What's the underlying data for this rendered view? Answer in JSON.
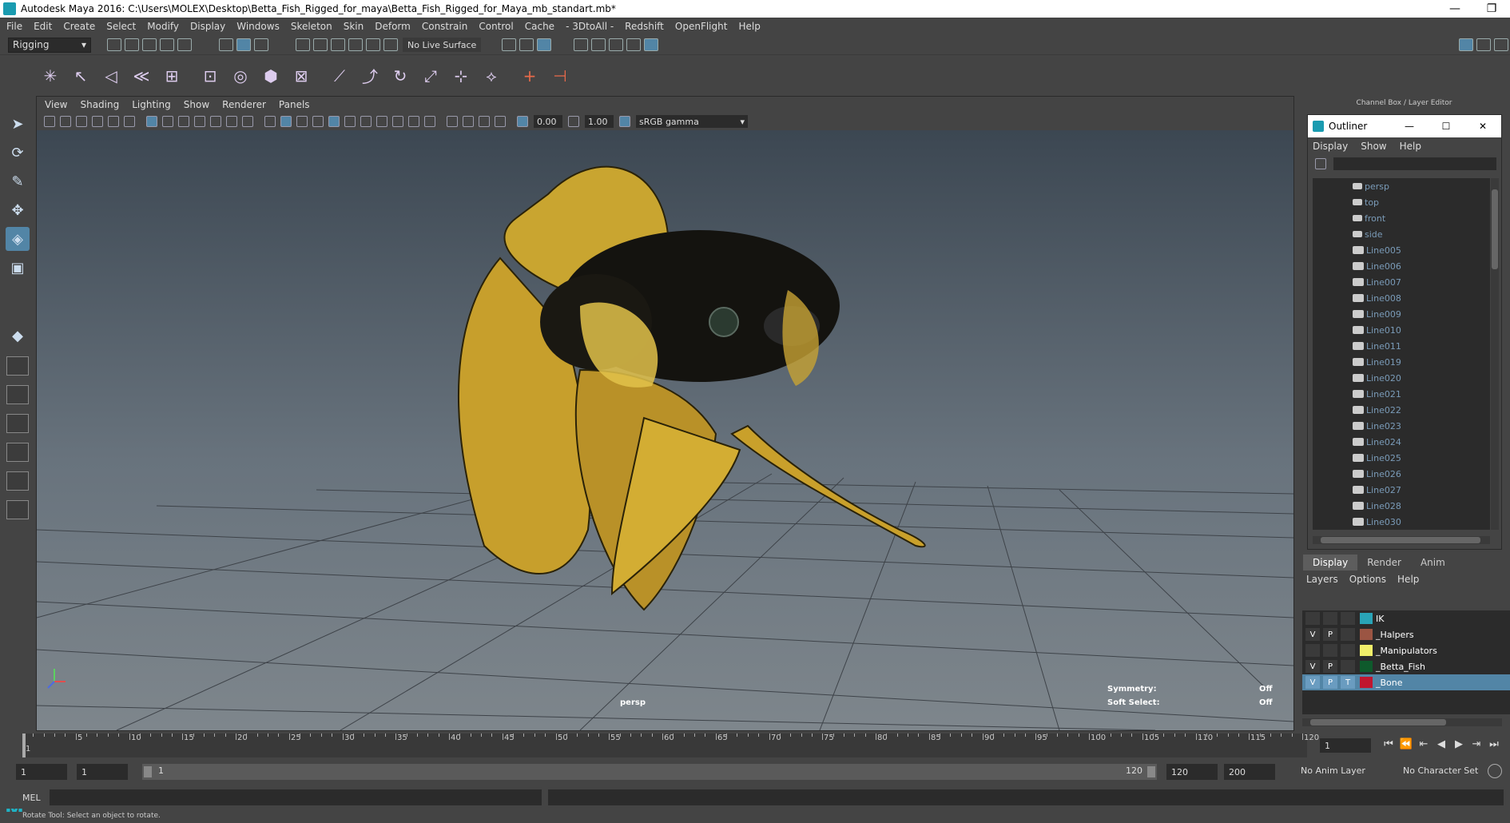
{
  "window": {
    "title": "Autodesk Maya 2016: C:\\Users\\MOLEX\\Desktop\\Betta_Fish_Rigged_for_maya\\Betta_Fish_Rigged_for_Maya_mb_standart.mb*",
    "minimize": "—",
    "restore": "❐"
  },
  "menubar": [
    "File",
    "Edit",
    "Create",
    "Select",
    "Modify",
    "Display",
    "Windows",
    "Skeleton",
    "Skin",
    "Deform",
    "Constrain",
    "Control",
    "Cache",
    "- 3DtoAll -",
    "Redshift",
    "OpenFlight",
    "Help"
  ],
  "statusline": {
    "mode": "Rigging",
    "live_surface": "No Live Surface"
  },
  "viewport": {
    "menu": [
      "View",
      "Shading",
      "Lighting",
      "Show",
      "Renderer",
      "Panels"
    ],
    "field1": "0.00",
    "field2": "1.00",
    "gamma": "sRGB gamma",
    "camera_label": "persp",
    "hud": {
      "symmetry_label": "Symmetry:",
      "symmetry_value": "Off",
      "soft_select_label": "Soft Select:",
      "soft_select_value": "Off"
    }
  },
  "right_panel_header": "Channel Box / Layer Editor",
  "outliner": {
    "title": "Outliner",
    "menu": [
      "Display",
      "Show",
      "Help"
    ],
    "items": [
      {
        "label": "persp",
        "icon": "camera-icon"
      },
      {
        "label": "top",
        "icon": "camera-icon"
      },
      {
        "label": "front",
        "icon": "camera-icon"
      },
      {
        "label": "side",
        "icon": "camera-icon"
      },
      {
        "label": "Line005",
        "icon": "curve-icon"
      },
      {
        "label": "Line006",
        "icon": "curve-icon"
      },
      {
        "label": "Line007",
        "icon": "curve-icon"
      },
      {
        "label": "Line008",
        "icon": "curve-icon"
      },
      {
        "label": "Line009",
        "icon": "curve-icon"
      },
      {
        "label": "Line010",
        "icon": "curve-icon"
      },
      {
        "label": "Line011",
        "icon": "curve-icon"
      },
      {
        "label": "Line019",
        "icon": "curve-icon"
      },
      {
        "label": "Line020",
        "icon": "curve-icon"
      },
      {
        "label": "Line021",
        "icon": "curve-icon"
      },
      {
        "label": "Line022",
        "icon": "curve-icon"
      },
      {
        "label": "Line023",
        "icon": "curve-icon"
      },
      {
        "label": "Line024",
        "icon": "curve-icon"
      },
      {
        "label": "Line025",
        "icon": "curve-icon"
      },
      {
        "label": "Line026",
        "icon": "curve-icon"
      },
      {
        "label": "Line027",
        "icon": "curve-icon"
      },
      {
        "label": "Line028",
        "icon": "curve-icon"
      },
      {
        "label": "Line030",
        "icon": "curve-icon"
      }
    ]
  },
  "layer_editor": {
    "tabs": [
      "Display",
      "Render",
      "Anim"
    ],
    "menu": [
      "Layers",
      "Options",
      "Help"
    ],
    "layers": [
      {
        "v": "",
        "p": "",
        "t": "",
        "color": "#29a3b6",
        "name": "IK",
        "selected": false
      },
      {
        "v": "V",
        "p": "P",
        "t": "",
        "color": "#9b5543",
        "name": "_Halpers",
        "selected": false
      },
      {
        "v": "",
        "p": "",
        "t": "",
        "color": "#f1ef6a",
        "name": "_Manipulators",
        "selected": false
      },
      {
        "v": "V",
        "p": "P",
        "t": "",
        "color": "#0e5a2c",
        "name": "_Betta_Fish",
        "selected": false
      },
      {
        "v": "V",
        "p": "P",
        "t": "T",
        "color": "#c0162f",
        "name": "_Bone",
        "selected": true
      }
    ]
  },
  "timeline": {
    "ticks": [
      "5",
      "10",
      "15",
      "20",
      "25",
      "30",
      "35",
      "40",
      "45",
      "50",
      "55",
      "60",
      "65",
      "70",
      "75",
      "80",
      "85",
      "90",
      "95",
      "100",
      "105",
      "110",
      "115",
      "120"
    ],
    "first_label": "1",
    "current_frame": "1"
  },
  "range": {
    "start": "1",
    "playback_start": "1",
    "slider_start": "1",
    "slider_end": "120",
    "playback_end": "120",
    "end": "200",
    "anim_layer": "No Anim Layer",
    "character_set": "No Character Set"
  },
  "command": {
    "label": "MEL"
  },
  "help_line": "Rotate Tool: Select an object to rotate."
}
